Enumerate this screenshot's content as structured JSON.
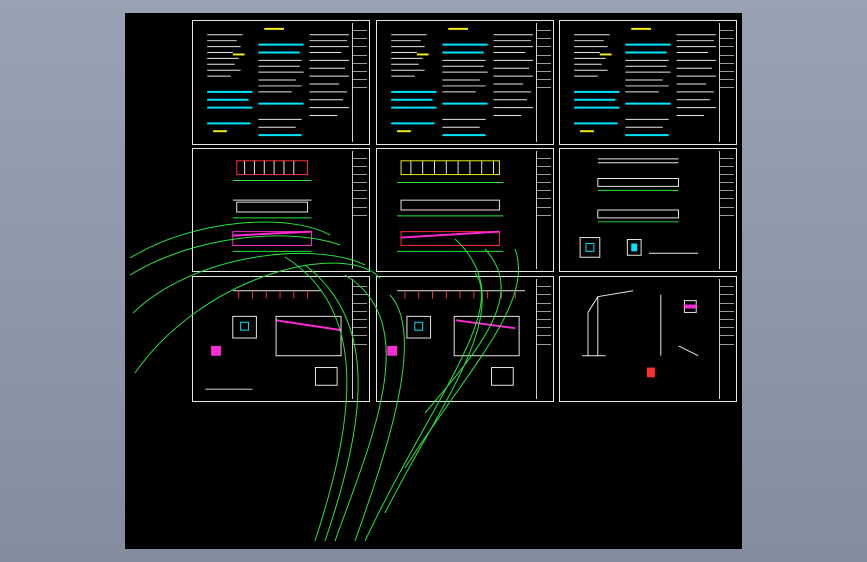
{
  "window": {
    "background_top": "#98a2b2",
    "background_bottom": "#838d9d"
  },
  "viewport": {
    "background": "#000000"
  },
  "sheets": [
    {
      "name": "sheet-design-notes-1",
      "kind": "notes"
    },
    {
      "name": "sheet-design-notes-2",
      "kind": "notes"
    },
    {
      "name": "sheet-design-notes-3",
      "kind": "notes"
    },
    {
      "name": "sheet-elevation-1",
      "kind": "elevation"
    },
    {
      "name": "sheet-elevation-2",
      "kind": "elevation"
    },
    {
      "name": "sheet-plan-details",
      "kind": "plan"
    },
    {
      "name": "sheet-foundation-1",
      "kind": "detail"
    },
    {
      "name": "sheet-foundation-2",
      "kind": "detail"
    },
    {
      "name": "sheet-frame-section",
      "kind": "frame"
    }
  ],
  "colors": {
    "line_white": "#e8e8e8",
    "line_green": "#27e53a",
    "line_cyan": "#00e5ff",
    "line_yellow": "#f2ee18",
    "line_magenta": "#ff2bd6",
    "line_red": "#ff3030"
  }
}
